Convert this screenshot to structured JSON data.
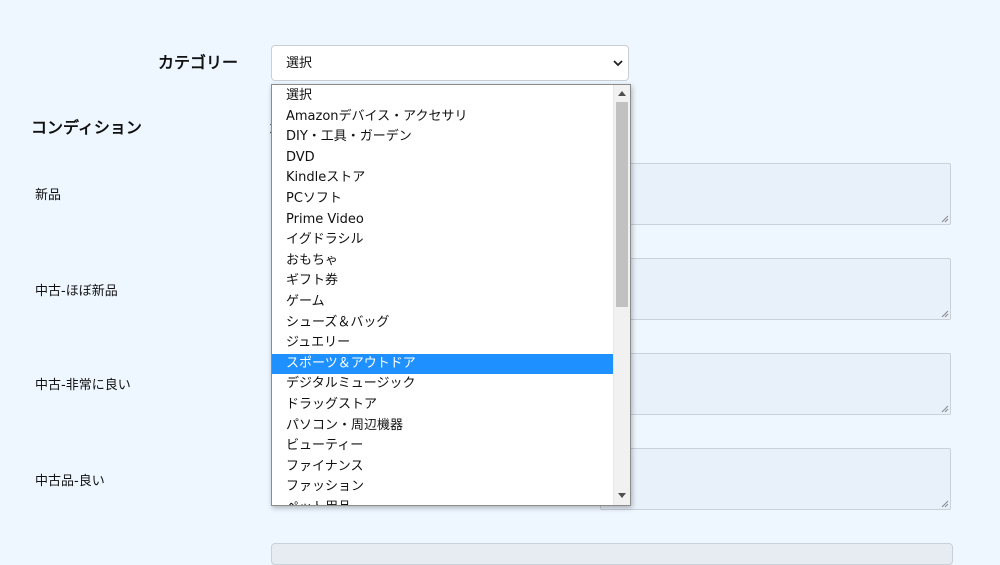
{
  "category": {
    "label": "カテゴリー",
    "selected": "選択",
    "options": [
      "選択",
      "Amazonデバイス・アクセサリ",
      "DIY・工具・ガーデン",
      "DVD",
      "Kindleストア",
      "PCソフト",
      "Prime Video",
      "イグドラシル",
      "おもちゃ",
      "ギフト券",
      "ゲーム",
      "シューズ＆バッグ",
      "ジュエリー",
      "スポーツ＆アウトドア",
      "デジタルミュージック",
      "ドラッグストア",
      "パソコン・周辺機器",
      "ビューティー",
      "ファイナンス",
      "ファッション",
      "ペット用品"
    ],
    "highlighted_index": 13
  },
  "condition": {
    "title": "コンディション",
    "hidden_glyph": "コ",
    "rows": [
      {
        "label": "新品"
      },
      {
        "label": "中古-ほぼ新品"
      },
      {
        "label": "中古-非常に良い"
      },
      {
        "label": "中古品-良い"
      }
    ]
  },
  "colors": {
    "page_bg": "#eef7ff",
    "highlight": "#1e90ff",
    "textarea_bg": "#e8f0fa"
  },
  "icons": {
    "select_chevron": "chevron-down-icon",
    "scroll_up": "triangle-up-icon",
    "scroll_down": "triangle-down-icon",
    "resize_grip": "resize-grip-icon"
  }
}
